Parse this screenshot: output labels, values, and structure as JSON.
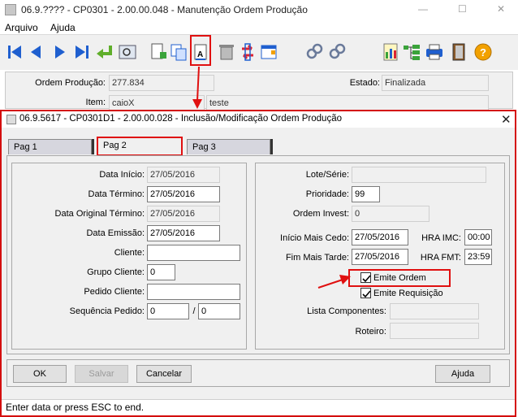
{
  "window": {
    "title": "06.9.???? - CP0301 - 2.00.00.048 - Manutenção Ordem Produção",
    "controls": {
      "minimize": "—",
      "maximize": "☐",
      "close": "✕"
    }
  },
  "menu": [
    "Arquivo",
    "Ajuda"
  ],
  "toolbar": {
    "icons": [
      "first-icon",
      "previous-icon",
      "next-icon",
      "last-icon",
      "go-to-icon",
      "zoom-icon",
      "new-icon",
      "copy-icon",
      "edit-icon",
      "delete-icon",
      "undo-icon",
      "grid-icon",
      "link-icon",
      "link-alt-icon",
      "report-icon",
      "tree-icon",
      "print-icon",
      "exit-icon",
      "help-icon"
    ],
    "colors": {
      "nav_blue": "#1f5fcf",
      "go_green": "#5fae2a",
      "help_orange": "#f2a100"
    }
  },
  "header": {
    "ordem_label": "Ordem Produção:",
    "ordem_value": "277.834",
    "estado_label": "Estado:",
    "estado_value": "Finalizada",
    "item_label": "Item:",
    "item_value": "caioX",
    "item_desc": "teste"
  },
  "dialog": {
    "title": "06.9.5617 - CP0301D1 - 2.00.00.028 - Inclusão/Modificação Ordem Produção",
    "close": "✕",
    "tabs": [
      "Pag 1",
      "Pag 2",
      "Pag 3"
    ],
    "active_tab": "Pag 2",
    "left": {
      "data_inicio_label": "Data Início:",
      "data_inicio": "27/05/2016",
      "data_termino_label": "Data Término:",
      "data_termino": "27/05/2016",
      "data_orig_label": "Data Original Término:",
      "data_orig": "27/05/2016",
      "data_emissao_label": "Data Emissão:",
      "data_emissao": "27/05/2016",
      "cliente_label": "Cliente:",
      "cliente": "",
      "grupo_label": "Grupo Cliente:",
      "grupo": "0",
      "pedido_label": "Pedido Cliente:",
      "pedido": "",
      "sequencia_label": "Sequência Pedido:",
      "sequencia_a": "0",
      "sequencia_sep": "/",
      "sequencia_b": "0"
    },
    "right": {
      "lote_label": "Lote/Série:",
      "lote": "",
      "prioridade_label": "Prioridade:",
      "prioridade": "99",
      "invest_label": "Ordem Invest:",
      "invest": "0",
      "inicio_cedo_label": "Início Mais Cedo:",
      "inicio_cedo": "27/05/2016",
      "hra_imc_label": "HRA IMC:",
      "hra_imc": "00:00",
      "fim_tarde_label": "Fim Mais Tarde:",
      "fim_tarde": "27/05/2016",
      "hra_fmt_label": "HRA FMT:",
      "hra_fmt": "23:59",
      "emite_ordem_label": "Emite Ordem",
      "emite_ordem": true,
      "emite_req_label": "Emite Requisição",
      "emite_req": true,
      "lista_label": "Lista Componentes:",
      "lista": "",
      "roteiro_label": "Roteiro:",
      "roteiro": ""
    },
    "buttons": {
      "ok": "OK",
      "salvar": "Salvar",
      "cancelar": "Cancelar",
      "ajuda": "Ajuda"
    }
  },
  "status": "Enter data or press ESC to end.",
  "colors": {
    "highlight_red": "#e01010",
    "panel_bg": "#f0f0f0"
  }
}
